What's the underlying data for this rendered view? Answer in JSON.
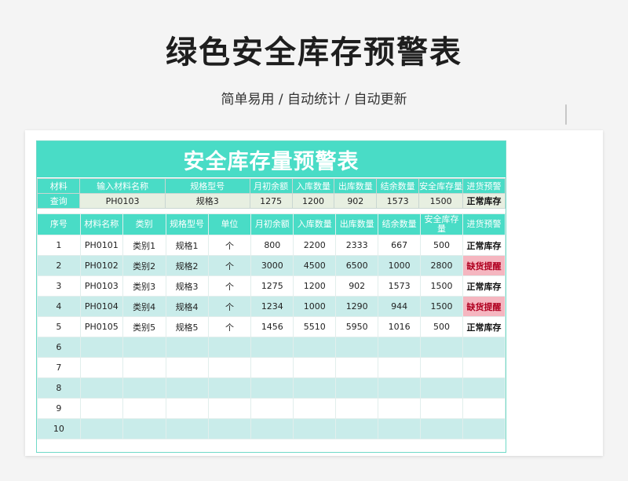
{
  "page": {
    "title": "绿色安全库存预警表",
    "subtitle": "简单易用 / 自动统计 / 自动更新"
  },
  "sheet": {
    "title": "安全库存量预警表",
    "query": {
      "label_top": "材料",
      "label_bottom": "查询",
      "headers": [
        "输入材料名称",
        "规格型号",
        "月初余额",
        "入库数量",
        "出库数量",
        "结余数量",
        "安全库存量",
        "进货预警"
      ],
      "values": [
        "PH0103",
        "规格3",
        "1275",
        "1200",
        "902",
        "1573",
        "1500",
        "正常库存"
      ]
    },
    "table": {
      "headers": [
        "序号",
        "材料名称",
        "类别",
        "规格型号",
        "单位",
        "月初余额",
        "入库数量",
        "出库数量",
        "结余数量",
        "安全库存量",
        "进货预警"
      ],
      "rows": [
        [
          "1",
          "PH0101",
          "类别1",
          "规格1",
          "个",
          "800",
          "2200",
          "2333",
          "667",
          "500",
          "正常库存"
        ],
        [
          "2",
          "PH0102",
          "类别2",
          "规格2",
          "个",
          "3000",
          "4500",
          "6500",
          "1000",
          "2800",
          "缺货提醒"
        ],
        [
          "3",
          "PH0103",
          "类别3",
          "规格3",
          "个",
          "1275",
          "1200",
          "902",
          "1573",
          "1500",
          "正常库存"
        ],
        [
          "4",
          "PH0104",
          "类别4",
          "规格4",
          "个",
          "1234",
          "1000",
          "1290",
          "944",
          "1500",
          "缺货提醒"
        ],
        [
          "5",
          "PH0105",
          "类别5",
          "规格5",
          "个",
          "1456",
          "5510",
          "5950",
          "1016",
          "500",
          "正常库存"
        ],
        [
          "6",
          "",
          "",
          "",
          "",
          "",
          "",
          "",
          "",
          "",
          ""
        ],
        [
          "7",
          "",
          "",
          "",
          "",
          "",
          "",
          "",
          "",
          "",
          ""
        ],
        [
          "8",
          "",
          "",
          "",
          "",
          "",
          "",
          "",
          "",
          "",
          ""
        ],
        [
          "9",
          "",
          "",
          "",
          "",
          "",
          "",
          "",
          "",
          "",
          ""
        ],
        [
          "10",
          "",
          "",
          "",
          "",
          "",
          "",
          "",
          "",
          "",
          ""
        ]
      ],
      "warn_value": "缺货提醒"
    }
  },
  "colors": {
    "accent": "#49dcc6",
    "stripe": "#c9ecea",
    "warn": "#f5b6c0",
    "query_fill": "#e7efe1"
  }
}
